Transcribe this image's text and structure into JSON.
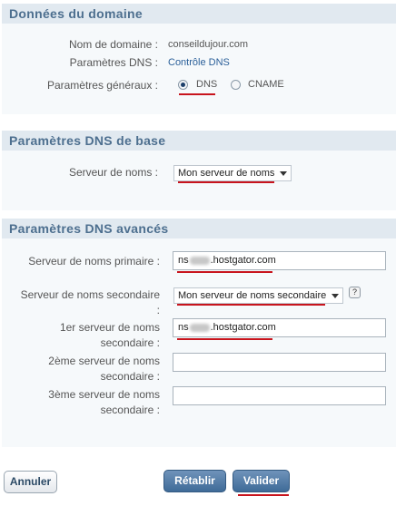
{
  "domain_section": {
    "title": "Données du domaine",
    "domain_name_label": "Nom de domaine :",
    "domain_name_value": "conseildujour.com",
    "dns_params_label": "Paramètres DNS :",
    "dns_control_link": "Contrôle DNS",
    "general_params_label": "Paramètres généraux :",
    "option_dns": "DNS",
    "option_cname": "CNAME",
    "selected_option": "DNS"
  },
  "basic_dns_section": {
    "title": "Paramètres DNS de base",
    "name_server_label": "Serveur de noms :",
    "name_server_value": "Mon serveur de noms"
  },
  "advanced_dns_section": {
    "title": "Paramètres DNS avancés",
    "primary_label": "Serveur de noms primaire :",
    "primary_prefix": "ns",
    "primary_suffix": ".hostgator.com",
    "secondary_label": "Serveur de noms secondaire :",
    "secondary_value": "Mon serveur de noms secondaire",
    "help_glyph": "?",
    "first_secondary_label": "1er serveur de noms secondaire :",
    "first_secondary_prefix": "ns",
    "first_secondary_suffix": ".hostgator.com",
    "second_secondary_label": "2ème serveur de noms secondaire :",
    "second_secondary_value": "",
    "third_secondary_label": "3ème serveur de noms secondaire :",
    "third_secondary_value": ""
  },
  "buttons": {
    "cancel": "Annuler",
    "reset": "Rétablir",
    "submit": "Valider"
  },
  "colors": {
    "section_header_bg": "#e1e9f0",
    "section_title": "#4d6f8f",
    "panel_bg": "#f6f9fb",
    "annotation_red": "#c8141d",
    "primary_button": "#3f6b98"
  }
}
